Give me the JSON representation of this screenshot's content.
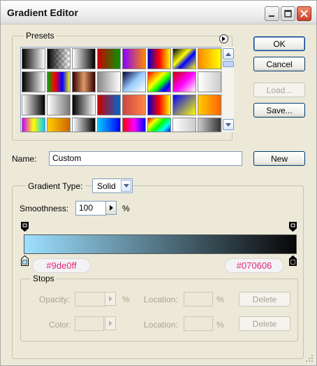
{
  "window": {
    "title": "Gradient Editor"
  },
  "presets": {
    "label": "Presets",
    "menu_icon": "play-circle-icon",
    "swatches": [
      "linear-gradient(90deg,#000,#fff)",
      "linear-gradient(90deg,#000,transparent)",
      "linear-gradient(90deg,#fff,#000)",
      "linear-gradient(90deg,#c00,#090)",
      "linear-gradient(90deg,#80f,#f80)",
      "linear-gradient(90deg,#00c,#f00,#ff0)",
      "linear-gradient(135deg,#002,#ff0 40%,#00f 60%,#ff0)",
      "linear-gradient(90deg,#f80,#ff0)",
      "linear-gradient(90deg,#000,#fff)",
      "linear-gradient(90deg,#0a0,#f00,#00f,#ff0)",
      "linear-gradient(90deg,#300,#d96,#300)",
      "linear-gradient(90deg,#888,#fff)",
      "linear-gradient(135deg,#003,#9cf,#fff)",
      "linear-gradient(135deg,#f00,#f80,#ff0,#0f0,#00f,#80f)",
      "linear-gradient(135deg,#c00,#f0f,#fff)",
      "linear-gradient(90deg,#fff,#ccc)",
      "linear-gradient(90deg,#fff,#000)",
      "linear-gradient(90deg,#fff,#777)",
      "linear-gradient(90deg,#000,#fff)",
      "linear-gradient(90deg,#c00,#06c)",
      "linear-gradient(90deg,#c44,#f84)",
      "linear-gradient(90deg,#00c,#f00,#ff0)",
      "linear-gradient(135deg,#00f,#ff0)",
      "linear-gradient(90deg,#fc0,#f60)",
      "linear-gradient(90deg,#c0f,#ff0,#0cf)",
      "linear-gradient(90deg,#fc0,#c60)",
      "linear-gradient(90deg,#fff,#000)",
      "linear-gradient(90deg,#0cf,#00f)",
      "linear-gradient(90deg,#f00,#f0f,#00f)",
      "linear-gradient(135deg,#f00,#ff0,#0f0,#0ff,#00f)",
      "linear-gradient(90deg,#fff,#ccc)",
      "linear-gradient(90deg,#ccc,#333)"
    ]
  },
  "buttons": {
    "ok": "OK",
    "cancel": "Cancel",
    "load": "Load...",
    "save": "Save...",
    "new": "New"
  },
  "name_field": {
    "label": "Name:",
    "value": "Custom"
  },
  "gradient": {
    "type_label": "Gradient Type:",
    "type_value": "Solid",
    "smoothness_label": "Smoothness:",
    "smoothness_value": "100",
    "smoothness_unit": "%",
    "start_color": "#9de0ff",
    "end_color": "#070606",
    "start_label": "#9de0ff",
    "end_label": "#070606"
  },
  "stops": {
    "label": "Stops",
    "opacity_label": "Opacity:",
    "opacity_unit": "%",
    "location_label_1": "Location:",
    "location_unit_1": "%",
    "delete_label_1": "Delete",
    "color_label": "Color:",
    "location_label_2": "Location:",
    "location_unit_2": "%",
    "delete_label_2": "Delete"
  }
}
